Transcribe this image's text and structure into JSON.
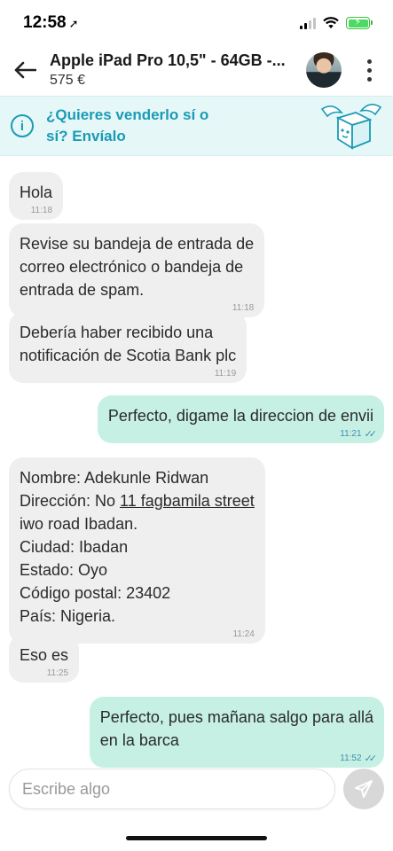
{
  "status_bar": {
    "time": "12:58",
    "location_glyph": "➚"
  },
  "header": {
    "title": "Apple iPad Pro 10,5\" - 64GB -...",
    "price": "575 €"
  },
  "banner": {
    "line1": "¿Quieres venderlo sí o",
    "line2": "sí? Envíalo",
    "info_glyph": "i"
  },
  "messages": [
    {
      "dir": "in",
      "lines": [
        "Hola"
      ],
      "time": "11:18"
    },
    {
      "dir": "in",
      "lines": [
        "Revise su bandeja de entrada de",
        "correo electrónico o bandeja de",
        "entrada de spam."
      ],
      "time": "11:18"
    },
    {
      "dir": "in",
      "lines": [
        "Debería haber recibido una",
        "notificación de Scotia Bank plc"
      ],
      "time": "11:19"
    },
    {
      "dir": "out",
      "lines": [
        "Perfecto, digame la direccion de envii"
      ],
      "time": "11:21"
    },
    {
      "dir": "in",
      "lines": [
        "Nombre: Adekunle Ridwan",
        "Dirección: No ",
        "11 fagbamila street",
        "iwo road Ibadan.",
        "Ciudad: Ibadan",
        "Estado: Oyo",
        "Código postal: 23402",
        "País: Nigeria."
      ],
      "time": "11:24"
    },
    {
      "dir": "in",
      "lines": [
        "Eso es"
      ],
      "time": "11:25"
    },
    {
      "dir": "out",
      "lines": [
        "Perfecto, pues mañana salgo para allá",
        "en la barca"
      ],
      "time": "11:52"
    }
  ],
  "input": {
    "placeholder": "Escribe algo"
  },
  "ticks": "✓✓",
  "colors": {
    "accent": "#1a9bb5",
    "outgoing_bubble": "#c6f0e4",
    "incoming_bubble": "#efefef"
  }
}
